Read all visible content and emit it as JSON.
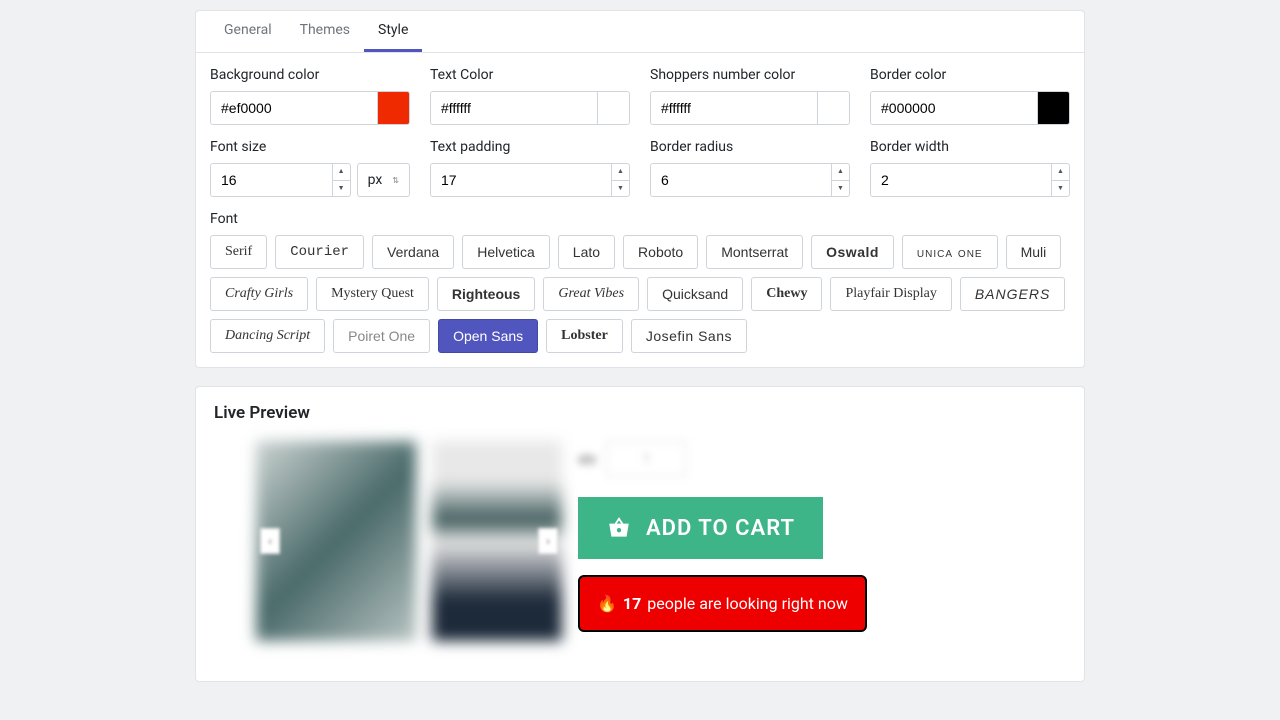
{
  "tabs": {
    "general": "General",
    "themes": "Themes",
    "style": "Style"
  },
  "labels": {
    "bg": "Background color",
    "text": "Text Color",
    "shoppers": "Shoppers number color",
    "border": "Border color",
    "fsize": "Font size",
    "tpad": "Text padding",
    "bradius": "Border radius",
    "bwidth": "Border width",
    "font": "Font"
  },
  "values": {
    "bg": "#ef0000",
    "text": "#ffffff",
    "shoppers": "#ffffff",
    "border": "#000000",
    "fsize": "16",
    "fsize_unit": "px",
    "tpad": "17",
    "bradius": "6",
    "bwidth": "2"
  },
  "swatches": {
    "bg": "#ef2a00",
    "text": "#ffffff",
    "shoppers": "#ffffff",
    "border": "#000000"
  },
  "fonts": [
    "Serif",
    "Courier",
    "Verdana",
    "Helvetica",
    "Lato",
    "Roboto",
    "Montserrat",
    "Oswald",
    "unica one",
    "Muli",
    "Crafty Girls",
    "Mystery Quest",
    "Righteous",
    "Great Vibes",
    "Quicksand",
    "Chewy",
    "Playfair Display",
    "BANGERS",
    "Dancing Script",
    "Poiret One",
    "Open Sans",
    "Lobster",
    "Josefin Sans"
  ],
  "font_classes": [
    "f-serif",
    "f-courier",
    "f-verdana",
    "f-helvetica",
    "",
    "",
    "",
    "f-oswald",
    "f-unica",
    "",
    "f-script",
    "f-medieval",
    "f-righteous",
    "f-script",
    "f-quicksand",
    "f-chewy",
    "f-playfair",
    "f-bangers",
    "f-script",
    "f-poiret",
    "",
    "f-lobster",
    "f-josefin"
  ],
  "selected_font": 20,
  "preview": {
    "title": "Live Preview",
    "qty_label": "qty",
    "qty_val": "1",
    "add_to_cart": "ADD TO CART",
    "fire": "🔥",
    "count": "17",
    "tail": "people are looking right now"
  }
}
